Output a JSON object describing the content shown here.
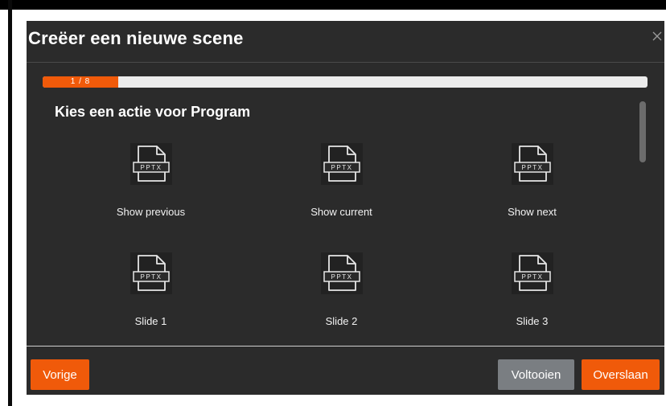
{
  "dialog": {
    "title": "Creëer een nieuwe scene",
    "close_icon": "close-icon"
  },
  "progress": {
    "label": "1 / 8",
    "current": 1,
    "total": 8,
    "fraction": 0.125,
    "fill_color": "#f05a0a"
  },
  "section": {
    "heading": "Kies een actie voor Program"
  },
  "actions": [
    {
      "label": "Show previous",
      "icon": "pptx-file-icon",
      "badge": "PPTX"
    },
    {
      "label": "Show current",
      "icon": "pptx-file-icon",
      "badge": "PPTX"
    },
    {
      "label": "Show next",
      "icon": "pptx-file-icon",
      "badge": "PPTX"
    },
    {
      "label": "Slide 1",
      "icon": "pptx-file-icon",
      "badge": "PPTX"
    },
    {
      "label": "Slide 2",
      "icon": "pptx-file-icon",
      "badge": "PPTX"
    },
    {
      "label": "Slide 3",
      "icon": "pptx-file-icon",
      "badge": "PPTX"
    }
  ],
  "footer": {
    "prev_label": "Vorige",
    "finish_label": "Voltooien",
    "skip_label": "Overslaan"
  },
  "colors": {
    "accent": "#f05a0a",
    "dialog_bg": "#2b2b2b",
    "secondary_button": "#7a7e82"
  }
}
